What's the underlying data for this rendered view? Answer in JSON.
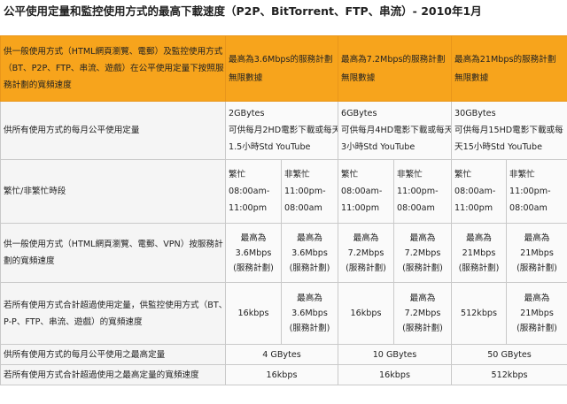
{
  "title": "公平使用定量和監控使用方式的最高下載速度（P2P、BitTorrent、FTP、串流）- 2010年1月",
  "header": {
    "label_lines": [
      "供一般使用方式（HTML網頁瀏覽、電郵）及監控使用方式",
      "（BT、P2P、FTP、串流、遊戲）在公平使用定量下按照服",
      "務計劃的寬頻速度"
    ],
    "plans": [
      [
        "最高為3.6Mbps的服務計劃",
        "無限數據"
      ],
      [
        "最高為7.2Mbps的服務計劃",
        "無限數據"
      ],
      [
        "最高為21Mbps的服務計劃",
        "無限數據"
      ]
    ]
  },
  "monthly": {
    "label": "供所有使用方式的每月公平使用定量",
    "plans": [
      [
        "2GBytes",
        "可供每月2HD電影下載或每天",
        "1.5小時Std YouTube"
      ],
      [
        "6GBytes",
        "可供每月4HD電影下載或每天",
        "3小時Std YouTube"
      ],
      [
        "30GBytes",
        "可供每月15HD電影下載或每",
        "天15小時Std YouTube"
      ]
    ]
  },
  "peak": {
    "label": "繁忙/非繁忙時段",
    "cells": [
      [
        "繁忙",
        "08:00am-",
        "11:00pm"
      ],
      [
        "非繁忙",
        "11:00pm-",
        "08:00am"
      ],
      [
        "繁忙",
        "08:00am-",
        "11:00pm"
      ],
      [
        "非繁忙",
        "11:00pm-",
        "08:00am"
      ],
      [
        "繁忙",
        "08:00am-",
        "11:00pm"
      ],
      [
        "非繁忙",
        "11:00pm-",
        "08:00am"
      ]
    ]
  },
  "general": {
    "label_lines": [
      "供一般使用方式（HTML網頁瀏覽、電郵、VPN）按服務計",
      "劃的寬頻速度"
    ],
    "cells": [
      [
        "最高為",
        "3.6Mbps",
        "(服務計劃)"
      ],
      [
        "最高為",
        "3.6Mbps",
        "(服務計劃)"
      ],
      [
        "最高為",
        "7.2Mbps",
        "(服務計劃)"
      ],
      [
        "最高為",
        "7.2Mbps",
        "(服務計劃)"
      ],
      [
        "最高為",
        "21Mbps",
        "(服務計劃)"
      ],
      [
        "最高為",
        "21Mbps",
        "(服務計劃)"
      ]
    ]
  },
  "exceeded": {
    "label_lines": [
      "若所有使用方式合計超過使用定量，供監控使用方式（BT、",
      "P-P、FTP、串流、遊戲）的寬頻速度"
    ],
    "cells": [
      [
        "16kbps"
      ],
      [
        "最高為",
        "3.6Mbps",
        "(服務計劃)"
      ],
      [
        "16kbps"
      ],
      [
        "最高為",
        "7.2Mbps",
        "(服務計劃)"
      ],
      [
        "512kbps"
      ],
      [
        "最高為",
        "21Mbps",
        "(服務計劃)"
      ]
    ]
  },
  "max_quota": {
    "label": "供所有使用方式的每月公平使用之最高定量",
    "plans": [
      "4 GBytes",
      "10 GBytes",
      "50 GBytes"
    ]
  },
  "max_exceeded": {
    "label": "若所有使用方式合計超過使用之最高定量的寬頻速度",
    "plans": [
      "16kbps",
      "16kbps",
      "512kbps"
    ]
  }
}
